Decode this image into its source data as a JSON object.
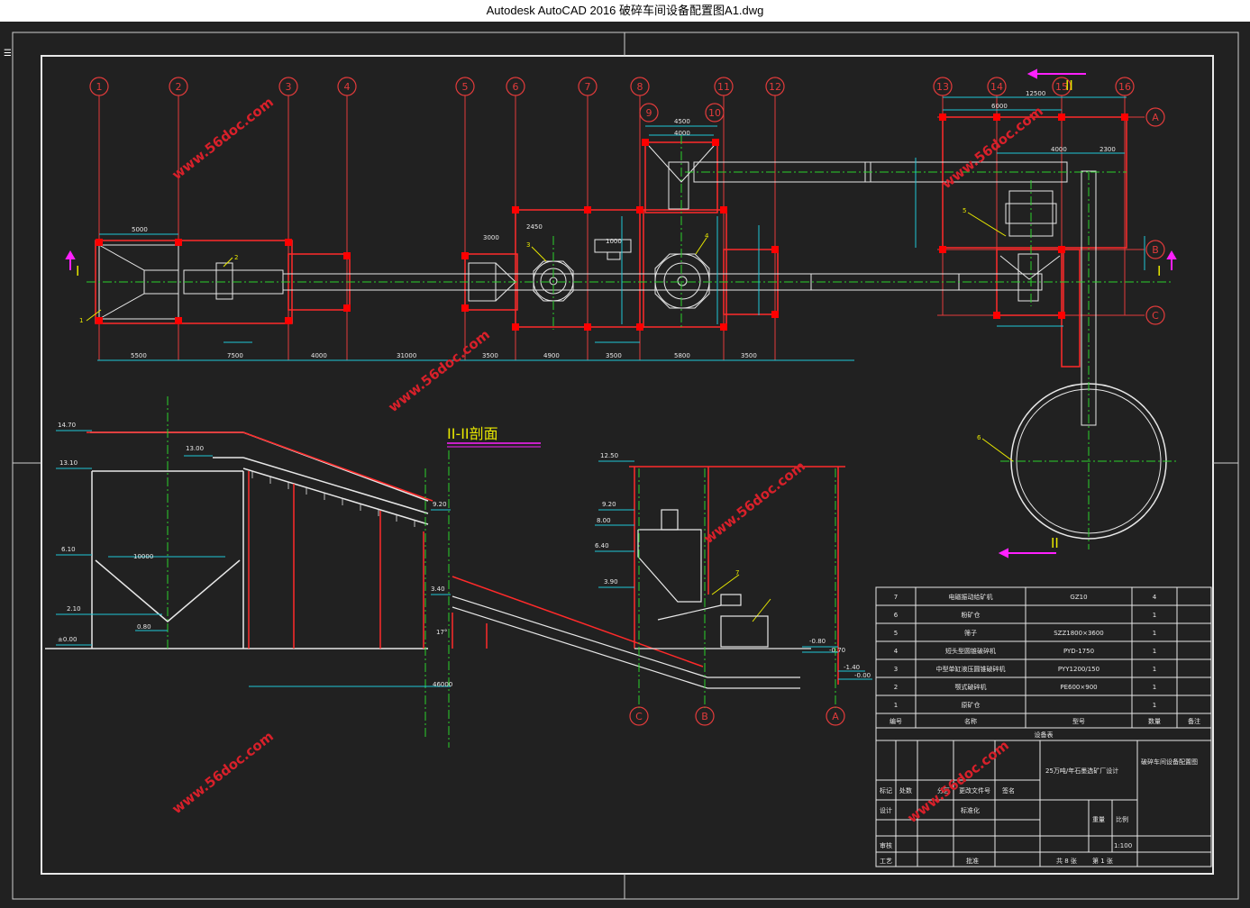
{
  "window": {
    "title": "Autodesk AutoCAD 2016     破碎车间设备配置图A1.dwg"
  },
  "icons": {
    "menu": "menu-icon"
  },
  "colors": {
    "background": "#212121",
    "titlebar": "#ffffff",
    "wall": "#ff2a2a",
    "axis": "#e23b3b",
    "grid": "#2bd12b",
    "dimension": "#1fc8d8",
    "white": "#e8e8e8",
    "yellow": "#e8e800",
    "magenta": "#ff20ff",
    "watermark": "#d8202a"
  },
  "drawing": {
    "section_title": "II-II剖面",
    "cut_marks": [
      "I",
      "I",
      "II",
      "II"
    ],
    "axis_numbers": [
      "1",
      "2",
      "3",
      "4",
      "5",
      "6",
      "7",
      "8",
      "9",
      "10",
      "11",
      "12",
      "13",
      "14",
      "15",
      "16"
    ],
    "axis_letters": [
      "A",
      "B",
      "C"
    ],
    "section_axis_letters": [
      "C",
      "B",
      "A"
    ],
    "plan_dims": [
      "5500",
      "7500",
      "4000",
      "31000",
      "3500",
      "4900",
      "3500",
      "5800",
      "3500"
    ],
    "plan_top_dims": [
      "5000",
      "4500",
      "4000",
      "12500",
      "6000",
      "4000",
      "2300",
      "3000",
      "2450",
      "1000"
    ],
    "elevations_left": [
      "14.70",
      "13.10",
      "6.10",
      "2.10",
      "±0.00",
      "0.80",
      "13.00"
    ],
    "elevations_mid": [
      "9.20",
      "3.40",
      "46000"
    ],
    "elevations_right": [
      "12.50",
      "9.20",
      "8.00",
      "6.40",
      "3.90",
      "-0.80",
      "-0.70",
      "-1.40",
      "-0.00"
    ],
    "equipment_callouts": [
      "1",
      "2",
      "3",
      "4",
      "5",
      "6",
      "7"
    ],
    "hopper_width": "10000",
    "slope_angle": "17°"
  },
  "equipment_table": {
    "rows": [
      {
        "no": "7",
        "name": "电磁振动给矿机",
        "model": "GZ10",
        "qty": "4",
        "note": ""
      },
      {
        "no": "6",
        "name": "粉矿仓",
        "model": "",
        "qty": "1",
        "note": ""
      },
      {
        "no": "5",
        "name": "筛子",
        "model": "SZZ1800×3600",
        "qty": "1",
        "note": ""
      },
      {
        "no": "4",
        "name": "短头型圆锥破碎机",
        "model": "PYD-1750",
        "qty": "1",
        "note": ""
      },
      {
        "no": "3",
        "name": "中型单缸液压圆锥破碎机",
        "model": "PYY1200/150",
        "qty": "1",
        "note": ""
      },
      {
        "no": "2",
        "name": "颚式破碎机",
        "model": "PE600×900",
        "qty": "1",
        "note": ""
      },
      {
        "no": "1",
        "name": "原矿仓",
        "model": "",
        "qty": "1",
        "note": ""
      }
    ],
    "header": {
      "no": "编号",
      "name": "名称",
      "model": "型号",
      "qty": "数量",
      "note": "备注"
    },
    "caption": "设备表"
  },
  "title_block": {
    "project": "25万吨/年石墨选矿厂设计",
    "drawing_name": "破碎车间设备配置图",
    "r1": [
      "标记",
      "处数",
      "分区",
      "更改文件号",
      "签名"
    ],
    "r2": [
      "设计",
      "",
      "标准化"
    ],
    "weight": "重量",
    "scale_label": "比例",
    "scale": "1:100",
    "check": "审核",
    "process": "工艺",
    "approve": "批准",
    "sheets": "共 8 张",
    "sheet_no": "第 1 张"
  },
  "watermarks": [
    "www.56doc.com",
    "www.56doc.com",
    "www.56doc.com",
    "www.56doc.com",
    "www.56doc.com",
    "www.56doc.com",
    "www.56doc.com"
  ]
}
